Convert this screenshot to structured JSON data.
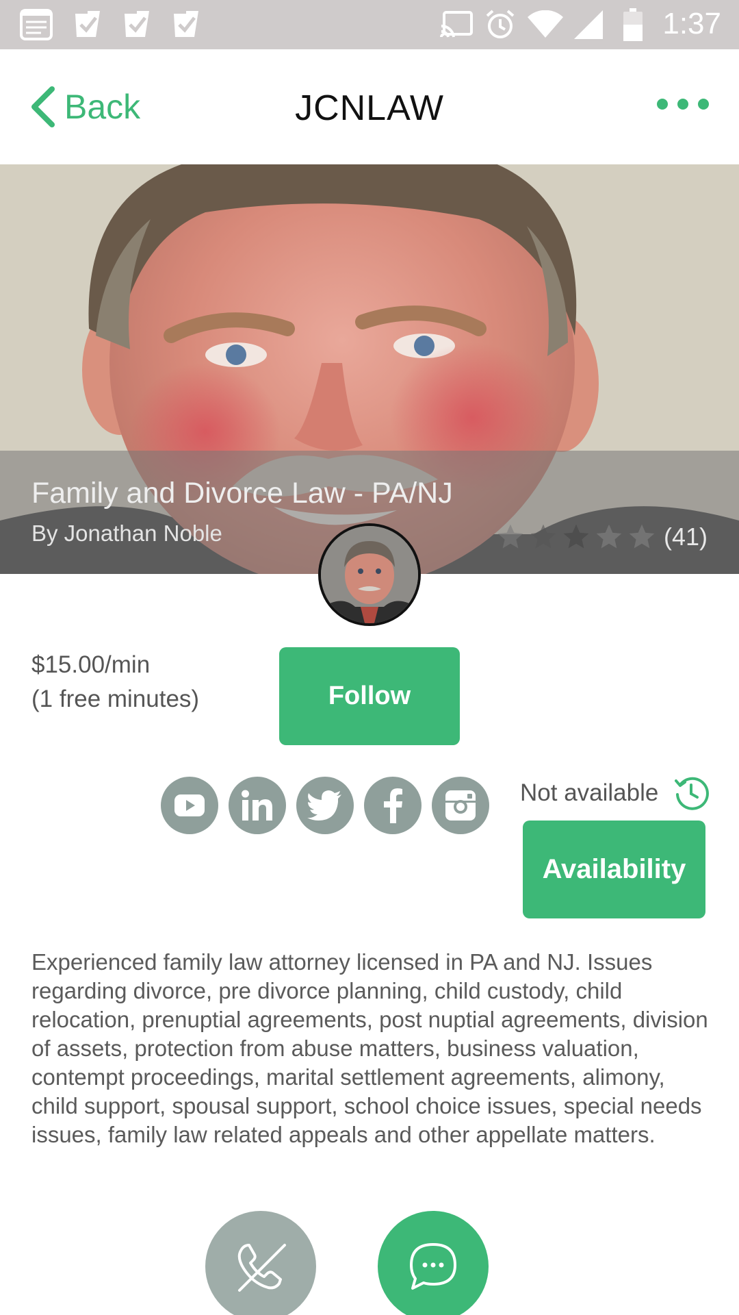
{
  "status_bar": {
    "time": "1:37",
    "icons": [
      "notification-icon",
      "check-bag-icon",
      "check-bag-icon",
      "check-bag-icon",
      "cast-icon",
      "alarm-icon",
      "wifi-icon",
      "signal-icon",
      "battery-icon"
    ]
  },
  "nav": {
    "back_label": "Back",
    "title": "JCNLAW",
    "more_icon": "more-dots-icon"
  },
  "hero": {
    "title": "Family and Divorce Law - PA/NJ",
    "author": "By Jonathan Noble",
    "rating_stars": 5,
    "rating_count": "(41)"
  },
  "pricing": {
    "rate": "$15.00/min",
    "free": "(1 free minutes)"
  },
  "buttons": {
    "follow": "Follow",
    "availability": "Availability"
  },
  "status": {
    "availability_text": "Not available"
  },
  "social": [
    "youtube-icon",
    "linkedin-icon",
    "twitter-icon",
    "facebook-icon",
    "instagram-icon"
  ],
  "description": "Experienced family law attorney licensed in PA and NJ. Issues regarding divorce, pre divorce planning, child custody, child relocation, prenuptial agreements, post nuptial agreements, division of assets, protection from abuse matters, business valuation, contempt proceedings, marital settlement agreements, alimony, child support, spousal support, school choice issues, special needs issues, family law related appeals and other appellate matters.",
  "colors": {
    "accent": "#3db877",
    "social_gray": "#8f9f9b",
    "status_bar": "#cfcbcb"
  }
}
